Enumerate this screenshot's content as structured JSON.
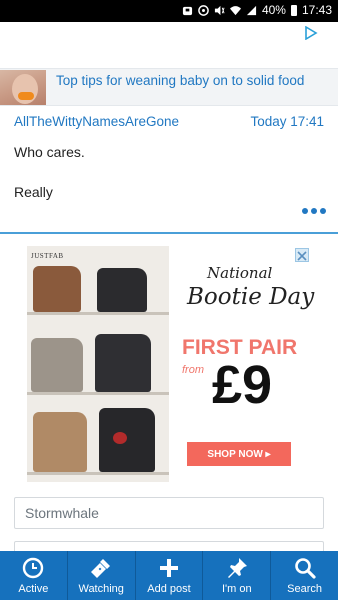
{
  "status_bar": {
    "battery": "40%",
    "time": "17:43",
    "icons": [
      "cloud-icon",
      "sync-icon",
      "mute-icon",
      "wifi-icon",
      "signal-icon",
      "battery-icon"
    ]
  },
  "ad_choices_icon": "ad-choices-icon",
  "tip_banner": {
    "text": "Top tips for weaning baby on to solid food"
  },
  "post": {
    "author": "AllTheWittyNamesAreGone",
    "time": "Today 17:41",
    "body": [
      "Who cares.",
      "Really"
    ],
    "more_icon": "more-dots-icon"
  },
  "ad": {
    "brand": "JUSTFAB",
    "title_line1": "National",
    "title_line2": "Bootie Day",
    "offer": "FIRST PAIR",
    "from": "from",
    "price": "£9",
    "button": "SHOP NOW ▸",
    "close_icon": "close-icon"
  },
  "input": {
    "value": "Stormwhale"
  },
  "bottom_nav": [
    {
      "label": "Active",
      "icon": "clock-icon"
    },
    {
      "label": "Watching",
      "icon": "flashlight-icon"
    },
    {
      "label": "Add post",
      "icon": "plus-icon"
    },
    {
      "label": "I'm on",
      "icon": "pin-icon"
    },
    {
      "label": "Search",
      "icon": "search-icon"
    }
  ],
  "colors": {
    "accent": "#2178c2",
    "nav_bg": "#1671bd",
    "status_bar_bg": "#000000",
    "ad_accent": "#f3685c"
  }
}
